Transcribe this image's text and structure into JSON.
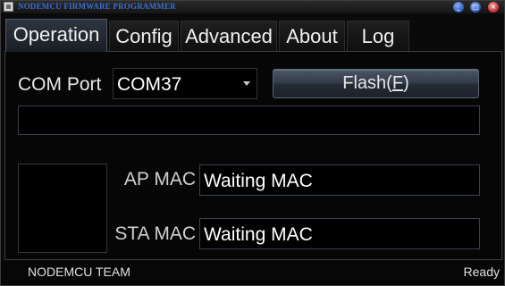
{
  "window": {
    "title": "NODEMCU FIRMWARE PROGRAMMER",
    "app_icon": "app-icon",
    "buttons": {
      "minimize": "_",
      "maximize": "□",
      "close": "×"
    }
  },
  "tabs": [
    {
      "label": "Operation",
      "active": true
    },
    {
      "label": "Config",
      "active": false
    },
    {
      "label": "Advanced",
      "active": false
    },
    {
      "label": "About",
      "active": false
    },
    {
      "label": "Log",
      "active": false
    }
  ],
  "operation": {
    "com_port_label": "COM Port",
    "com_port_value": "COM37",
    "flash_label": "Flash(",
    "flash_mnemonic": "F",
    "flash_label_end": ")",
    "progress": 0,
    "ap_mac_label": "AP MAC",
    "ap_mac_value": "Waiting MAC",
    "sta_mac_label": "STA MAC",
    "sta_mac_value": "Waiting MAC"
  },
  "statusbar": {
    "left": "NODEMCU TEAM",
    "right": "Ready"
  },
  "colors": {
    "title_text": "#3c6fd0",
    "background": "#060606",
    "accent_button": "#343d4a"
  }
}
